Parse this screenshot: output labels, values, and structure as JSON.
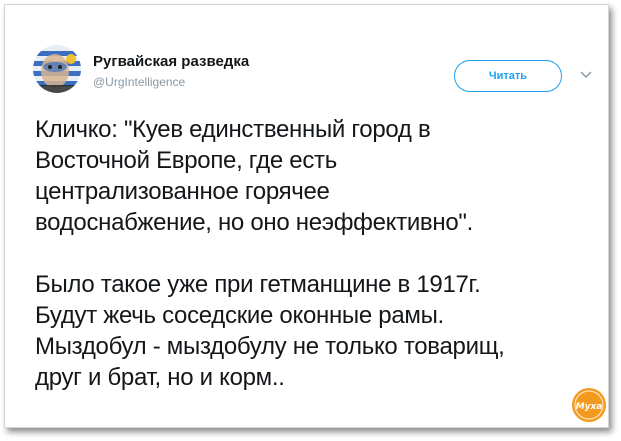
{
  "tweet": {
    "display_name": "Ругвайская разведка",
    "handle": "@UrgIntelligence",
    "follow_label": "Читать",
    "text": "Кличко: \"Куев единственный город в\nВосточной Европе, где есть\nцентрализованное горячее\nводоснабжение, но оно неэффективно\".\n\nБыло такое уже при гетманщине в 1917г.\nБудут жечь соседские оконные рамы.\nМыздобул - мыздобулу не только товарищ,\nдруг и брат, но и корм.."
  },
  "watermark": {
    "text": "Муха"
  },
  "colors": {
    "accent": "#1da1f2",
    "text": "#14171a",
    "secondary_text": "#8899a6",
    "watermark_orange": "#f39a1e"
  },
  "icons": {
    "avatar": "uruguay-flag-face-avatar",
    "caret": "chevron-down-icon",
    "watermark": "muha-logo"
  }
}
